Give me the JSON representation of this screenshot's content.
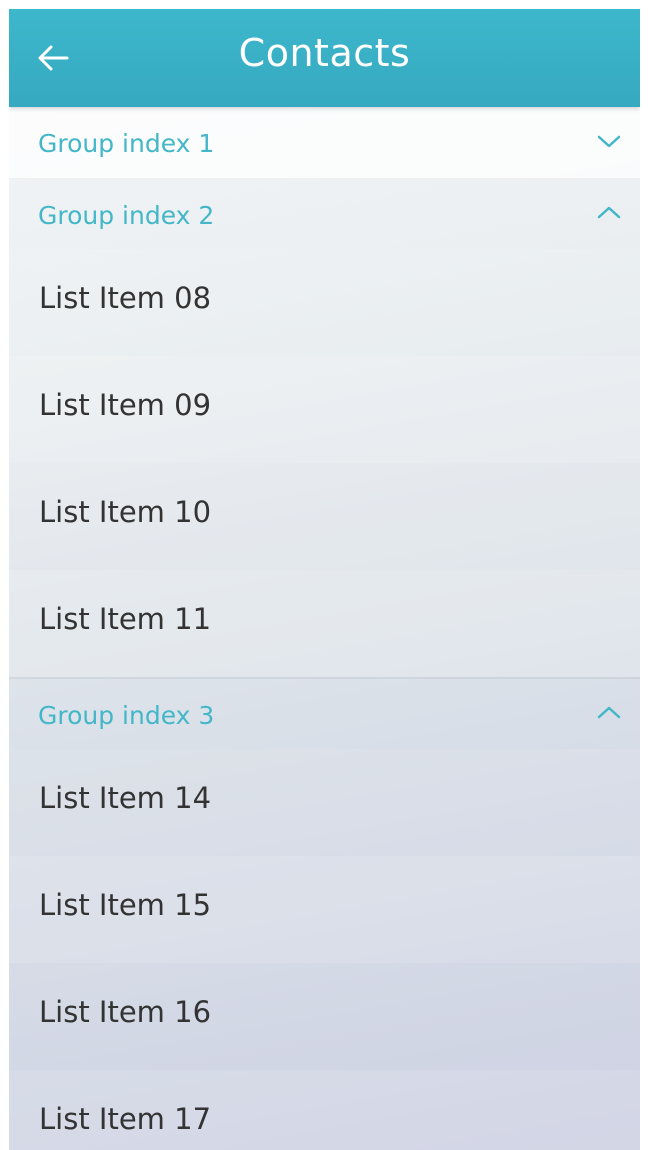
{
  "header": {
    "title": "Contacts",
    "back_icon": "arrow-left-icon"
  },
  "groups": [
    {
      "label": "Group index 1",
      "state_icon": "chevron-down-icon",
      "items": []
    },
    {
      "label": "Group index 2",
      "state_icon": "chevron-up-icon",
      "items": [
        {
          "label": "List Item 08"
        },
        {
          "label": "List Item 09"
        },
        {
          "label": "List Item 10"
        },
        {
          "label": "List Item 11"
        }
      ]
    },
    {
      "label": "Group index 3",
      "state_icon": "chevron-up-icon",
      "items": [
        {
          "label": "List Item 14"
        },
        {
          "label": "List Item 15"
        },
        {
          "label": "List Item 16"
        },
        {
          "label": "List Item 17"
        }
      ]
    }
  ],
  "colors": {
    "header_bg": "#3db7cb",
    "group_label": "#43b7c8",
    "item_text": "#333333"
  }
}
